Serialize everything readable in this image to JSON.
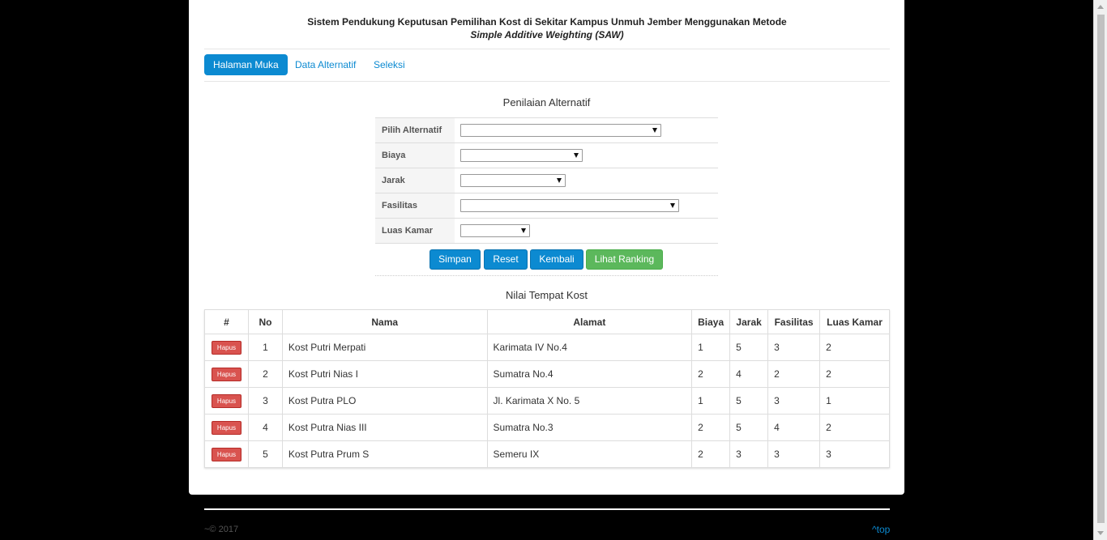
{
  "header": {
    "title_line1": "Sistem Pendukung Keputusan Pemilihan Kost di Sekitar Kampus Unmuh Jember Menggunakan Metode",
    "title_line2": "Simple Additive Weighting (SAW)"
  },
  "nav": {
    "tabs": [
      {
        "label": "Halaman Muka",
        "active": true
      },
      {
        "label": "Data Alternatif",
        "active": false
      },
      {
        "label": "Seleksi",
        "active": false
      }
    ]
  },
  "form": {
    "title": "Penilaian Alternatif",
    "fields": [
      {
        "label": "Pilih Alternatif",
        "value": ""
      },
      {
        "label": "Biaya",
        "value": ""
      },
      {
        "label": "Jarak",
        "value": ""
      },
      {
        "label": "Fasilitas",
        "value": ""
      },
      {
        "label": "Luas Kamar",
        "value": ""
      }
    ],
    "buttons": {
      "simpan": "Simpan",
      "reset": "Reset",
      "kembali": "Kembali",
      "lihat_ranking": "Lihat Ranking"
    }
  },
  "table": {
    "title": "Nilai Tempat Kost",
    "headers": [
      "#",
      "No",
      "Nama",
      "Alamat",
      "Biaya",
      "Jarak",
      "Fasilitas",
      "Luas Kamar"
    ],
    "delete_label": "Hapus",
    "rows": [
      {
        "no": "1",
        "nama": "Kost Putri Merpati",
        "alamat": "Karimata IV No.4",
        "biaya": "1",
        "jarak": "5",
        "fasilitas": "3",
        "luas": "2"
      },
      {
        "no": "2",
        "nama": "Kost Putri Nias I",
        "alamat": "Sumatra No.4",
        "biaya": "2",
        "jarak": "4",
        "fasilitas": "2",
        "luas": "2"
      },
      {
        "no": "3",
        "nama": "Kost Putra PLO",
        "alamat": "Jl. Karimata X No. 5",
        "biaya": "1",
        "jarak": "5",
        "fasilitas": "3",
        "luas": "1"
      },
      {
        "no": "4",
        "nama": "Kost Putra Nias III",
        "alamat": "Sumatra No.3",
        "biaya": "2",
        "jarak": "5",
        "fasilitas": "4",
        "luas": "2"
      },
      {
        "no": "5",
        "nama": "Kost Putra Prum S",
        "alamat": "Semeru IX",
        "biaya": "2",
        "jarak": "3",
        "fasilitas": "3",
        "luas": "3"
      }
    ]
  },
  "footer": {
    "copyright": "~© 2017",
    "top_link": "^top"
  },
  "colors": {
    "primary": "#0c8ad1",
    "success": "#5cb85c",
    "danger": "#d9534f"
  }
}
